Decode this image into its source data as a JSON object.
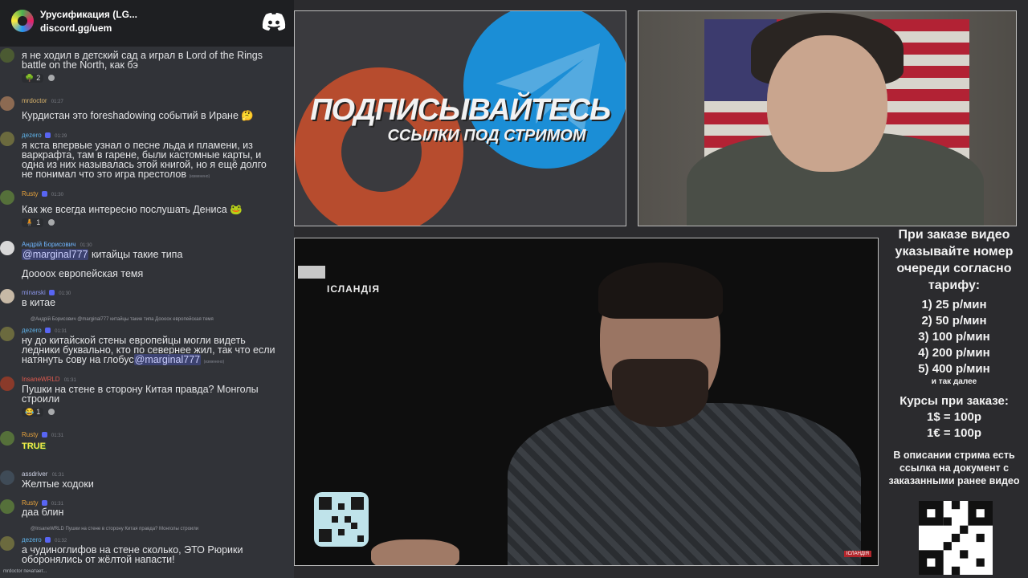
{
  "chat": {
    "server_name": "Урусификация (LG...",
    "server_invite": "discord.gg/uem",
    "typing": "mrdoctor печатает...",
    "messages": [
      {
        "text": "я не ходил в детский сад а играл в Lord of the Rings\nbattle on the North, как бэ",
        "reaction_count": "2"
      },
      {
        "user": "mrdoctor",
        "time": "01:27",
        "text": "Курдистан это foreshadowing событий в Иране 🤔"
      },
      {
        "user": "дezero",
        "time": "01:29",
        "text": "я кста впервые узнал о песне льда и пламени, из\nваркрафта, там в гарене, были кастомные карты, и\nодна из них называлась этой книгой, но я ещё долго\nне понимал что это игра престолов",
        "edited": "(изменено)"
      },
      {
        "user": "Rusty",
        "time": "01:30",
        "text": "Как же всегда интересно послушать Дениса 🐸",
        "reaction_count": "1"
      },
      {
        "user": "Андрій Борисович",
        "time": "01:30",
        "mention": "@marginal777",
        "text": "китайцы такие типа",
        "text2": "Доооох европейская темя"
      },
      {
        "user": "minarski",
        "time": "01:30",
        "text": "в китае"
      },
      {
        "reply": "@Андрій Борисович @marginal777 китайцы такие типа  Доооох европейская темя",
        "user": "дezero",
        "time": "01:31",
        "text": "ну до китайской стены европейцы могли видеть\nледники буквально, кто по севернее жил, так что если\nнатянуть сову на глобус",
        "mention": "@marginal777",
        "edited": "(изменено)"
      },
      {
        "user": "InsaneWRLD",
        "time": "01:31",
        "text": "Пушки на стене в сторону Китая правда? Монголы\nстроили",
        "reaction_count": "1"
      },
      {
        "user": "Rusty",
        "time": "01:31",
        "text": "TRUE"
      },
      {
        "user": "assdriver",
        "time": "01:31",
        "text": "Желтые ходоки"
      },
      {
        "user": "Rusty",
        "time": "01:31",
        "text": "даа блин"
      },
      {
        "reply": "@InsaneWRLD Пушки на стене в сторону Китая правда? Монголы строили",
        "user": "дezero",
        "time": "01:32",
        "text": "а чудиноглифов на стене сколько, ЭТО Рюрики\nоборонялись от жёлтой напасти!"
      }
    ]
  },
  "promo": {
    "title": "ПОДПИСЫВАЙТЕСЬ",
    "subtitle": "ССЫЛКИ ПОД СТРИМОМ"
  },
  "video": {
    "label": "ІСЛАНДІЯ",
    "watermark": "ІСЛАНДІЯ"
  },
  "info": {
    "heading": "При заказе видео указывайте номер очереди согласно тарифу:",
    "rates": [
      "1) 25 р/мин",
      "2) 50 р/мин",
      "3) 100 р/мин",
      "4) 200 р/мин",
      "5) 400 р/мин"
    ],
    "rates_more": "и так далее",
    "course_heading": "Курсы при заказе:",
    "courses": [
      "1$ = 100р",
      "1€ = 100р"
    ],
    "description": "В описании стрима есть ссылка на документ с заказанными ранее видео"
  },
  "colors": {
    "chat_bg": "#313338",
    "mention_bg": "#3c4270",
    "telegram_blue": "#1b8ed6",
    "patreon_orange": "#b74c2e"
  }
}
